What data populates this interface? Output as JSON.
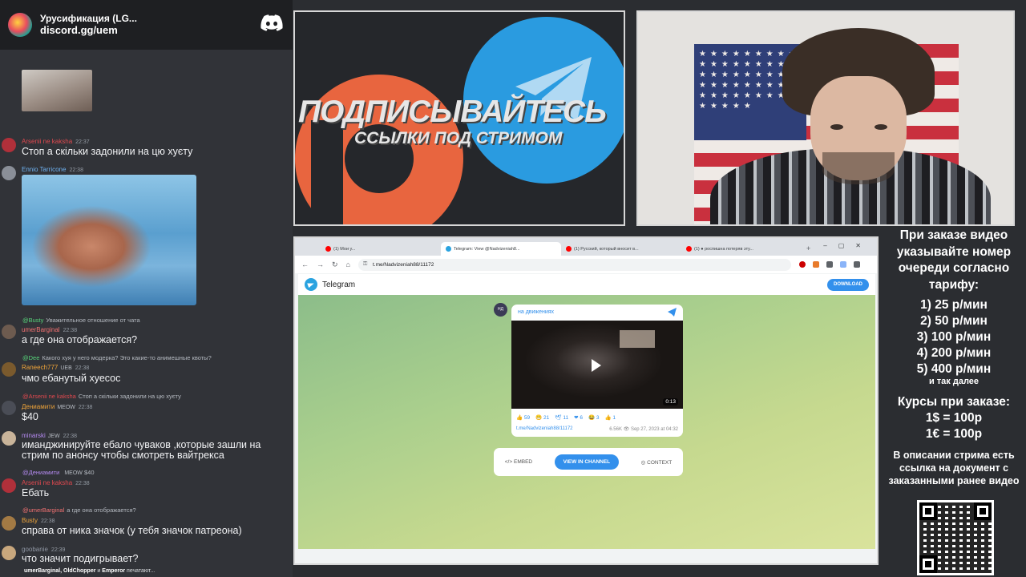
{
  "server": {
    "title": "Урусификация (LG...",
    "link": "discord.gg/uem"
  },
  "chat": {
    "messages": [
      {
        "user": "Arsenii ne kaksha",
        "time": "22:37",
        "text": "Стоп а скільки задонили на цю хуєту"
      },
      {
        "user": "Ennio Tarricone",
        "time": "22:38",
        "text": ""
      },
      {
        "reply_user": "@Busty",
        "reply_text": "Уважительное отношение от чата",
        "user": "umerBarginal",
        "time": "22:38",
        "text": "а где она отображается?"
      },
      {
        "reply_user": "@Dee",
        "reply_text": "Какого хуя у него модерка? Это какие-то анимешные квоты?",
        "user": "Raneech777",
        "badge": "UEB",
        "time": "22:38",
        "text": "чмо ебанутый хуесос"
      },
      {
        "reply_user": "@Arsenii ne kaksha",
        "reply_text": "Стоп а скільки задонили на цю хуєту",
        "user": "Дениамити",
        "badge": "MEOW",
        "time": "22:38",
        "text": "$40"
      },
      {
        "user": "minarski",
        "badge": "JEW",
        "time": "22:38",
        "text_line1": "иманджинируйте ебало чуваков ,которые зашли на",
        "text_line2": "стрим по анонсу чтобы смотреть вайтрекса"
      },
      {
        "reply_user": "@Дениамити",
        "reply_badge": "MEOW",
        "reply_text": "$40",
        "user": "Arsenii ne kaksha",
        "time": "22:38",
        "text": "Ебать"
      },
      {
        "reply_user": "@umerBarginal",
        "reply_text": "а где она отображается?",
        "user": "Busty",
        "time": "22:38",
        "text": "справа от ника значок (у тебя значок патреона)"
      },
      {
        "user": "goobanie",
        "time": "22:39",
        "text": "что значит подигрывает?"
      }
    ],
    "typing_users": "umerBarginal, OldChopper",
    "typing_and": " и ",
    "typing_last": "Emperor",
    "typing_suffix": " печатают..."
  },
  "banner": {
    "title": "ПОДПИСЫВАЙТЕСЬ",
    "subtitle": "ССЫЛКИ ПОД СТРИМОМ"
  },
  "browser": {
    "tabs": [
      {
        "label": "(1) Мои у...",
        "active": false,
        "color": "#ff0000"
      },
      {
        "label": "Telegram: View @Nadvizeniah8...",
        "active": true,
        "color": "#2aa3e0"
      },
      {
        "label": "(1) Русский, который вносит в...",
        "active": false,
        "color": "#ff0000"
      },
      {
        "label": "(1) ● роспишна потеряв эту...",
        "active": false,
        "color": "#ff0000"
      }
    ],
    "url": "t.me/Nadvizeniah88/11172"
  },
  "telegram": {
    "app_name": "Telegram",
    "download_label": "DOWNLOAD",
    "channel_name": "на движениях",
    "channel_avatar_text": "НД",
    "video_duration": "0:13",
    "reactions": [
      "👍 59",
      "😁 21",
      "🕊 11",
      "❤ 6",
      "😂 3",
      "👍 1"
    ],
    "post_link": "t.me/Nadvizeniah88/11172",
    "views": "6.56K",
    "date": "Sep 27, 2023 at 04:32",
    "embed_label": "EMBED",
    "view_label": "VIEW IN CHANNEL",
    "context_label": "CONTEXT"
  },
  "info": {
    "order_text": "При заказе видео указывайте номер очереди согласно тарифу:",
    "tariffs": [
      "1) 25 р/мин",
      "2) 50 р/мин",
      "3) 100 р/мин",
      "4) 200 р/мин",
      "5) 400 р/мин"
    ],
    "etc": "и так далее",
    "rates_title": "Курсы при заказе:",
    "rate_usd": "1$ = 100р",
    "rate_eur": "1€ = 100р",
    "doc_note": "В описании стрима есть ссылка на документ с заказанными ранее видео"
  },
  "colors": {
    "discord_bg": "#313338",
    "telegram_blue": "#3390ec",
    "patreon_orange": "#e8653f"
  }
}
